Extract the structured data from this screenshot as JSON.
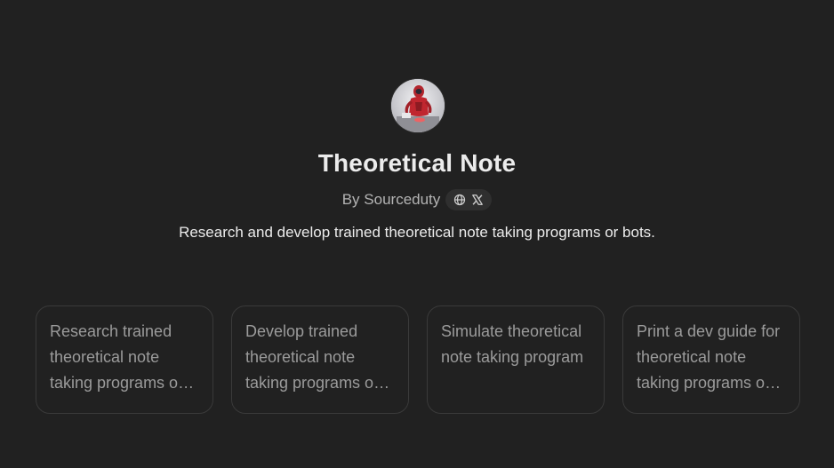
{
  "gpt": {
    "name": "Theoretical Note",
    "byline": "By Sourceduty",
    "description": "Research and develop trained theoretical note taking programs or bots.",
    "avatar_icon": "robot-avatar",
    "social_icons": [
      "globe-icon",
      "x-logo-icon"
    ]
  },
  "starters": [
    {
      "text": "Research trained theoretical note taking programs or bots."
    },
    {
      "text": "Develop trained theoretical note taking programs or bots."
    },
    {
      "text": "Simulate theoretical note taking program"
    },
    {
      "text": "Print a dev guide for theoretical note taking programs or bots."
    }
  ],
  "colors": {
    "background": "#212121",
    "title": "#ececec",
    "muted": "#b4b4b4",
    "card_border": "#3a3a3a",
    "card_text": "#9b9b9b"
  }
}
